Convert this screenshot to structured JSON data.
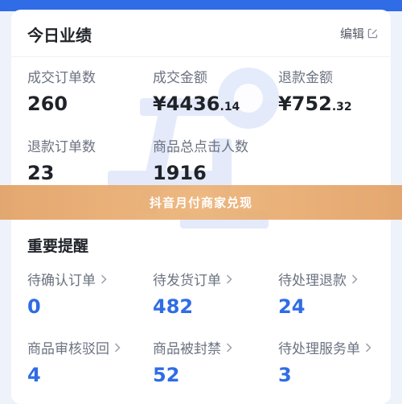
{
  "card": {
    "title": "今日业绩",
    "edit_label": "编辑"
  },
  "metrics": [
    {
      "label": "成交订单数",
      "value": "260"
    },
    {
      "label": "成交金额",
      "currency": "¥",
      "int": "4436",
      "dec": ".14"
    },
    {
      "label": "退款金额",
      "currency": "¥",
      "int": "752",
      "dec": ".32"
    },
    {
      "label": "退款订单数",
      "value": "23"
    },
    {
      "label": "商品总点击人数",
      "value": "1916"
    }
  ],
  "banner": {
    "text": "抖音月付商家兑现"
  },
  "reminders": {
    "title": "重要提醒",
    "items": [
      {
        "label": "待确认订单",
        "value": "0"
      },
      {
        "label": "待发货订单",
        "value": "482"
      },
      {
        "label": "待处理退款",
        "value": "24"
      },
      {
        "label": "商品审核驳回",
        "value": "4"
      },
      {
        "label": "商品被封禁",
        "value": "52"
      },
      {
        "label": "待处理服务单",
        "value": "3"
      }
    ]
  },
  "colors": {
    "accent": "#2f6ce6",
    "banner": "#e8a56b"
  }
}
